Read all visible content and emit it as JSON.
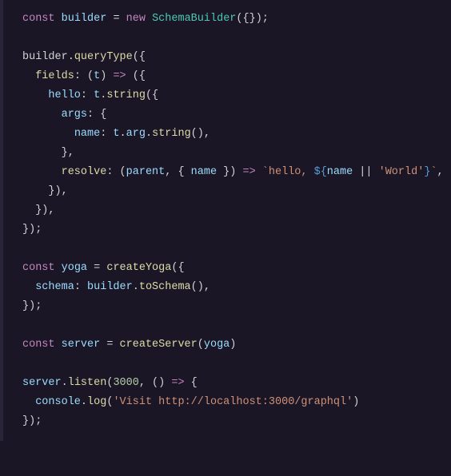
{
  "code": {
    "lines": [
      [
        {
          "t": "const",
          "c": "kw"
        },
        {
          "t": " ",
          "c": "plain"
        },
        {
          "t": "builder",
          "c": "var"
        },
        {
          "t": " = ",
          "c": "plain"
        },
        {
          "t": "new",
          "c": "kw"
        },
        {
          "t": " ",
          "c": "plain"
        },
        {
          "t": "SchemaBuilder",
          "c": "cls"
        },
        {
          "t": "({});",
          "c": "punc"
        }
      ],
      [],
      [
        {
          "t": "builder",
          "c": "plain"
        },
        {
          "t": ".",
          "c": "punc"
        },
        {
          "t": "queryType",
          "c": "fn"
        },
        {
          "t": "({",
          "c": "punc"
        }
      ],
      [
        {
          "t": "  ",
          "c": "plain"
        },
        {
          "t": "fields",
          "c": "fn"
        },
        {
          "t": ": (",
          "c": "punc"
        },
        {
          "t": "t",
          "c": "var"
        },
        {
          "t": ") ",
          "c": "punc"
        },
        {
          "t": "=>",
          "c": "kw"
        },
        {
          "t": " ({",
          "c": "punc"
        }
      ],
      [
        {
          "t": "    ",
          "c": "plain"
        },
        {
          "t": "hello",
          "c": "prop"
        },
        {
          "t": ": ",
          "c": "punc"
        },
        {
          "t": "t",
          "c": "var"
        },
        {
          "t": ".",
          "c": "punc"
        },
        {
          "t": "string",
          "c": "fn"
        },
        {
          "t": "({",
          "c": "punc"
        }
      ],
      [
        {
          "t": "      ",
          "c": "plain"
        },
        {
          "t": "args",
          "c": "prop"
        },
        {
          "t": ": {",
          "c": "punc"
        }
      ],
      [
        {
          "t": "        ",
          "c": "plain"
        },
        {
          "t": "name",
          "c": "prop"
        },
        {
          "t": ": ",
          "c": "punc"
        },
        {
          "t": "t",
          "c": "var"
        },
        {
          "t": ".",
          "c": "punc"
        },
        {
          "t": "arg",
          "c": "var"
        },
        {
          "t": ".",
          "c": "punc"
        },
        {
          "t": "string",
          "c": "fn"
        },
        {
          "t": "(),",
          "c": "punc"
        }
      ],
      [
        {
          "t": "      },",
          "c": "punc"
        }
      ],
      [
        {
          "t": "      ",
          "c": "plain"
        },
        {
          "t": "resolve",
          "c": "fn"
        },
        {
          "t": ": (",
          "c": "punc"
        },
        {
          "t": "parent",
          "c": "var"
        },
        {
          "t": ", { ",
          "c": "punc"
        },
        {
          "t": "name",
          "c": "var"
        },
        {
          "t": " }) ",
          "c": "punc"
        },
        {
          "t": "=>",
          "c": "kw"
        },
        {
          "t": " ",
          "c": "plain"
        },
        {
          "t": "`hello, ",
          "c": "str"
        },
        {
          "t": "${",
          "c": "tmpl"
        },
        {
          "t": "name",
          "c": "var"
        },
        {
          "t": " || ",
          "c": "plain"
        },
        {
          "t": "'World'",
          "c": "str"
        },
        {
          "t": "}",
          "c": "tmpl"
        },
        {
          "t": "`",
          "c": "str"
        },
        {
          "t": ",",
          "c": "punc"
        }
      ],
      [
        {
          "t": "    }),",
          "c": "punc"
        }
      ],
      [
        {
          "t": "  }),",
          "c": "punc"
        }
      ],
      [
        {
          "t": "});",
          "c": "punc"
        }
      ],
      [],
      [
        {
          "t": "const",
          "c": "kw"
        },
        {
          "t": " ",
          "c": "plain"
        },
        {
          "t": "yoga",
          "c": "var"
        },
        {
          "t": " = ",
          "c": "plain"
        },
        {
          "t": "createYoga",
          "c": "fn"
        },
        {
          "t": "({",
          "c": "punc"
        }
      ],
      [
        {
          "t": "  ",
          "c": "plain"
        },
        {
          "t": "schema",
          "c": "prop"
        },
        {
          "t": ": ",
          "c": "punc"
        },
        {
          "t": "builder",
          "c": "var"
        },
        {
          "t": ".",
          "c": "punc"
        },
        {
          "t": "toSchema",
          "c": "fn"
        },
        {
          "t": "(),",
          "c": "punc"
        }
      ],
      [
        {
          "t": "});",
          "c": "punc"
        }
      ],
      [],
      [
        {
          "t": "const",
          "c": "kw"
        },
        {
          "t": " ",
          "c": "plain"
        },
        {
          "t": "server",
          "c": "var"
        },
        {
          "t": " = ",
          "c": "plain"
        },
        {
          "t": "createServer",
          "c": "fn"
        },
        {
          "t": "(",
          "c": "punc"
        },
        {
          "t": "yoga",
          "c": "var"
        },
        {
          "t": ")",
          "c": "punc"
        }
      ],
      [],
      [
        {
          "t": "server",
          "c": "var"
        },
        {
          "t": ".",
          "c": "punc"
        },
        {
          "t": "listen",
          "c": "fn"
        },
        {
          "t": "(",
          "c": "punc"
        },
        {
          "t": "3000",
          "c": "num"
        },
        {
          "t": ", () ",
          "c": "punc"
        },
        {
          "t": "=>",
          "c": "kw"
        },
        {
          "t": " {",
          "c": "punc"
        }
      ],
      [
        {
          "t": "  ",
          "c": "plain"
        },
        {
          "t": "console",
          "c": "var"
        },
        {
          "t": ".",
          "c": "punc"
        },
        {
          "t": "log",
          "c": "fn"
        },
        {
          "t": "(",
          "c": "punc"
        },
        {
          "t": "'Visit http://localhost:3000/graphql'",
          "c": "str"
        },
        {
          "t": ")",
          "c": "punc"
        }
      ],
      [
        {
          "t": "});",
          "c": "punc"
        }
      ]
    ]
  }
}
